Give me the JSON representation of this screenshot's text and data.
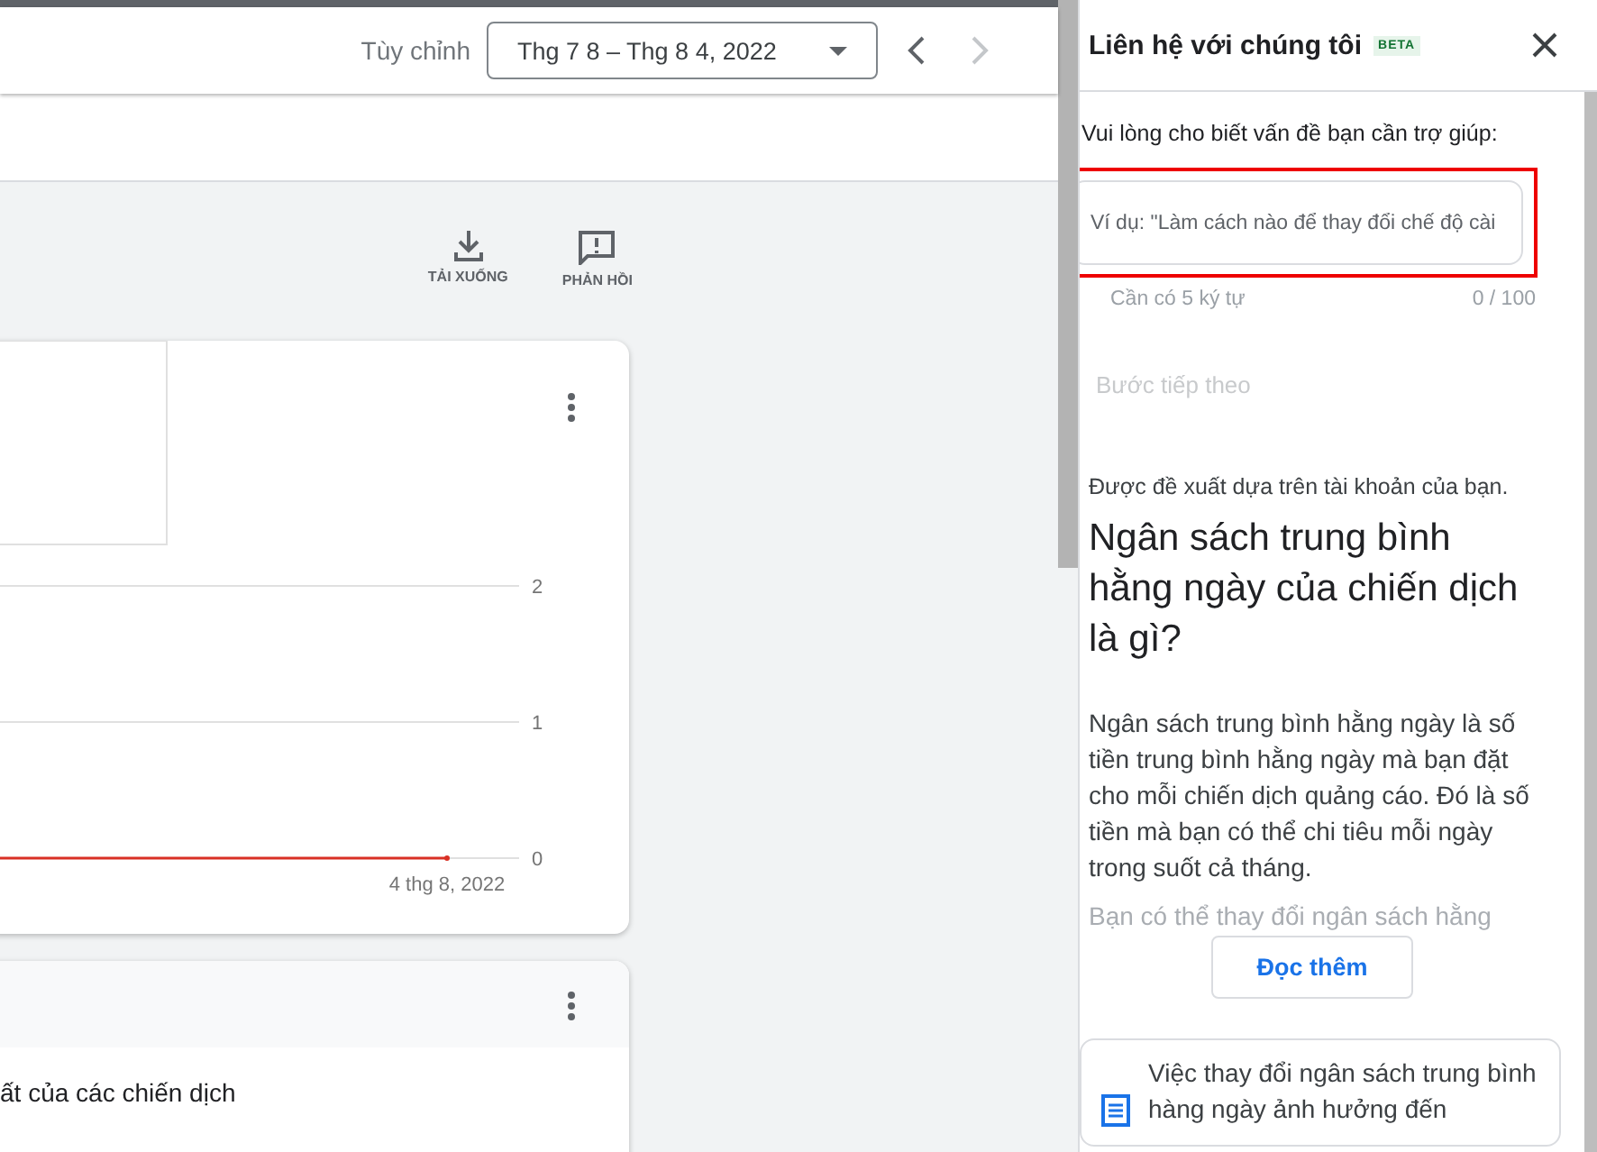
{
  "header": {
    "range_label": "Tùy chỉnh",
    "date_range": "Thg 7 8 – Thg 8 4, 2022"
  },
  "toolbar": [
    {
      "kind": "download",
      "label": "TẢI XUỐNG"
    },
    {
      "kind": "feedback",
      "label": "PHẢN HỒI"
    }
  ],
  "chart_card": {
    "chart_data": {
      "type": "line",
      "x": [
        "4 thg 8, 2022"
      ],
      "yticks": [
        0,
        1,
        2
      ],
      "ylim": [
        0,
        2
      ],
      "series": [
        {
          "color": "#d93025",
          "marker": true,
          "values": [
            0
          ]
        }
      ]
    }
  },
  "table_card": {
    "row_text": "ất của các chiến dịch"
  },
  "panel": {
    "title": "Liên hệ với chúng tôi",
    "badge": "BETA",
    "prompt": "Vui lòng cho biết vấn đề bạn cần trợ giúp:",
    "input": {
      "placeholder": "Ví dụ: \"Làm cách nào để thay đổi chế độ cài"
    },
    "hint": "Cần có 5 ký tự",
    "counter": "0 / 100",
    "next_button": {
      "label": "Bước tiếp theo",
      "disabled": true
    },
    "suggest_note": "Được đề xuất dựa trên tài khoản của bạn.",
    "article_title": "Ngân sách trung bình hằng ngày của chiến dịch là gì?",
    "article_body": "Ngân sách trung bình hằng ngày là số tiền trung bình hằng ngày mà bạn đặt cho mỗi chiến dịch quảng cáo. Đó là số tiền mà bạn có thể chi tiêu mỗi ngày trong suốt cả tháng.",
    "article_faded": "Bạn có thể thay đổi ngân sách hằng",
    "read_more": "Đọc thêm",
    "related": "Việc thay đổi ngân sách trung bình hàng ngày ảnh hưởng đến"
  }
}
